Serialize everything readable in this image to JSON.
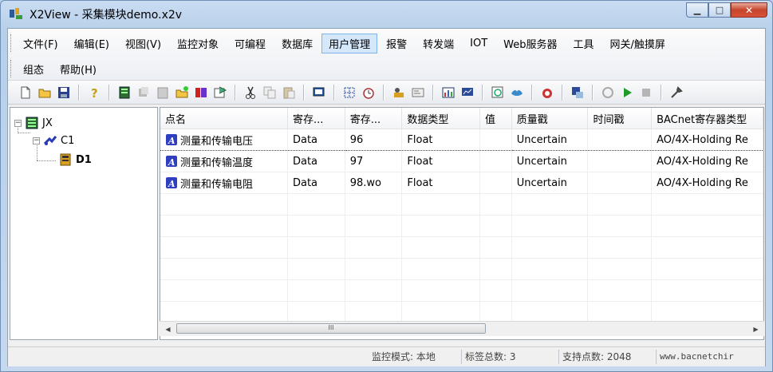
{
  "window": {
    "title": "X2View - 采集模块demo.x2v"
  },
  "menu": {
    "row1": [
      "文件(F)",
      "编辑(E)",
      "视图(V)",
      "监控对象",
      "可编程",
      "数据库",
      "用户管理",
      "报警",
      "转发端",
      "IOT",
      "Web服务器",
      "工具",
      "网关/触摸屏"
    ],
    "row2": [
      "组态",
      "帮助(H)"
    ],
    "active": "用户管理"
  },
  "toolbar": {
    "icons": [
      "new-icon",
      "open-icon",
      "save-icon",
      "help-icon",
      "device-icon",
      "copy-device-icon",
      "paste-device-icon",
      "folder-new-icon",
      "module-icon",
      "properties-icon",
      "cut-icon",
      "copy-icon",
      "paste-icon",
      "monitor-icon",
      "grid-icon",
      "timer-icon",
      "tool-icon",
      "card-icon",
      "chart-icon",
      "screen-icon",
      "browser-icon",
      "handshake-icon",
      "alarm-icon",
      "network-icon",
      "refresh-icon",
      "run-icon",
      "stop-icon",
      "settings-icon"
    ]
  },
  "tree": {
    "root": "JX",
    "channel": "C1",
    "device": "D1"
  },
  "grid": {
    "columns": [
      "点名",
      "寄存...",
      "寄存...",
      "数据类型",
      "值",
      "质量戳",
      "时间戳",
      "BACnet寄存器类型"
    ],
    "rows": [
      [
        "测量和传输电压",
        "Data",
        "96",
        "Float",
        "",
        "Uncertain",
        "",
        "AO/4X-Holding Re"
      ],
      [
        "测量和传输温度",
        "Data",
        "97",
        "Float",
        "",
        "Uncertain",
        "",
        "AO/4X-Holding Re"
      ],
      [
        "测量和传输电阻",
        "Data",
        "98.wo",
        "Float",
        "",
        "Uncertain",
        "",
        "AO/4X-Holding Re"
      ]
    ],
    "scroll_thumb": "III"
  },
  "status": {
    "mode": "监控模式: 本地",
    "tag_count": "标签总数: 3",
    "supported": "支持点数: 2048",
    "url": "www.bacnetchir"
  },
  "colors": {
    "accent": "#7eb4ea",
    "tag_icon": "#2f3fbf",
    "close": "#c7442c"
  }
}
